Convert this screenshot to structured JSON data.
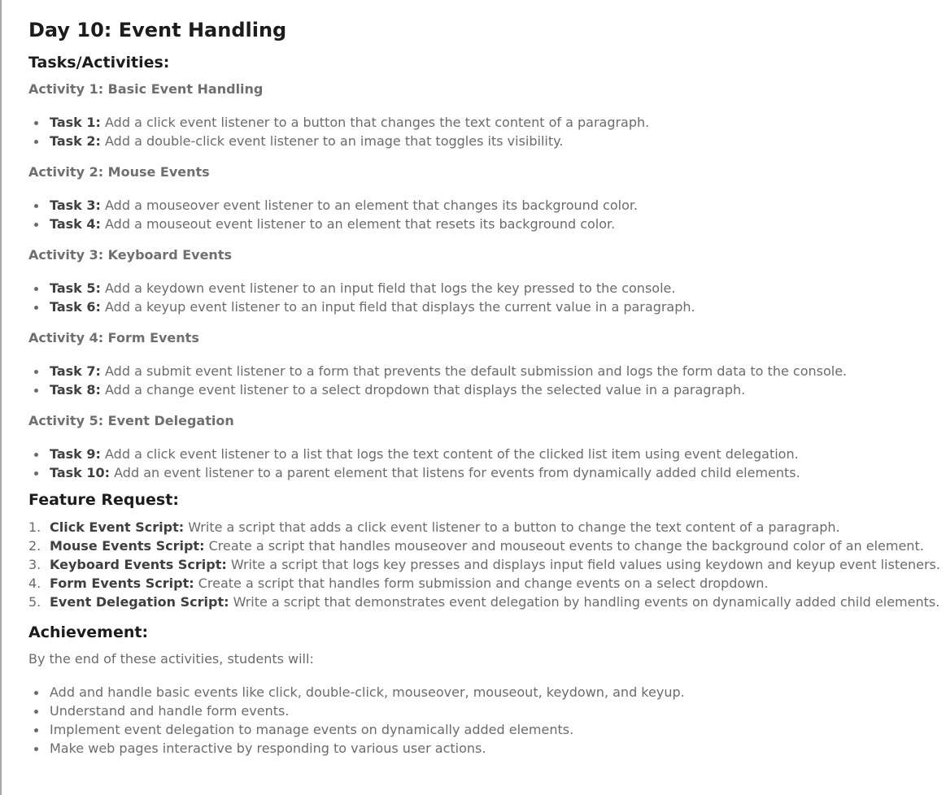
{
  "title": "Day 10: Event Handling",
  "tasks_heading": "Tasks/Activities:",
  "activities": [
    {
      "heading": "Activity 1: Basic Event Handling",
      "tasks": [
        {
          "label": "Task 1:",
          "text": " Add a click event listener to a button that changes the text content of a paragraph."
        },
        {
          "label": "Task 2:",
          "text": " Add a double-click event listener to an image that toggles its visibility."
        }
      ]
    },
    {
      "heading": "Activity 2: Mouse Events",
      "tasks": [
        {
          "label": "Task 3:",
          "text": " Add a mouseover event listener to an element that changes its background color."
        },
        {
          "label": "Task 4:",
          "text": " Add a mouseout event listener to an element that resets its background color."
        }
      ]
    },
    {
      "heading": "Activity 3: Keyboard Events",
      "tasks": [
        {
          "label": "Task 5:",
          "text": " Add a keydown event listener to an input field that logs the key pressed to the console."
        },
        {
          "label": "Task 6:",
          "text": " Add a keyup event listener to an input field that displays the current value in a paragraph."
        }
      ]
    },
    {
      "heading": "Activity 4: Form Events",
      "tasks": [
        {
          "label": "Task 7:",
          "text": " Add a submit event listener to a form that prevents the default submission and logs the form data to the console."
        },
        {
          "label": "Task 8:",
          "text": " Add a change event listener to a select dropdown that displays the selected value in a paragraph."
        }
      ]
    },
    {
      "heading": "Activity 5: Event Delegation",
      "tasks": [
        {
          "label": "Task 9:",
          "text": " Add a click event listener to a list that logs the text content of the clicked list item using event delegation."
        },
        {
          "label": "Task 10:",
          "text": " Add an event listener to a parent element that listens for events from dynamically added child elements."
        }
      ]
    }
  ],
  "feature_heading": "Feature Request:",
  "features": [
    {
      "num": "1.",
      "label": "Click Event Script:",
      "text": " Write a script that adds a click event listener to a button to change the text content of a paragraph."
    },
    {
      "num": "2.",
      "label": "Mouse Events Script:",
      "text": " Create a script that handles mouseover and mouseout events to change the background color of an element."
    },
    {
      "num": "3.",
      "label": "Keyboard Events Script:",
      "text": " Write a script that logs key presses and displays input field values using keydown and keyup event listeners."
    },
    {
      "num": "4.",
      "label": "Form Events Script:",
      "text": " Create a script that handles form submission and change events on a select dropdown."
    },
    {
      "num": "5.",
      "label": "Event Delegation Script:",
      "text": " Write a script that demonstrates event delegation by handling events on dynamically added child elements."
    }
  ],
  "achievement_heading": "Achievement:",
  "achievement_intro": "By the end of these activities, students will:",
  "achievements": [
    "Add and handle basic events like click, double-click, mouseover, mouseout, keydown, and keyup.",
    "Understand and handle form events.",
    "Implement event delegation to manage events on dynamically added elements.",
    "Make web pages interactive by responding to various user actions."
  ]
}
